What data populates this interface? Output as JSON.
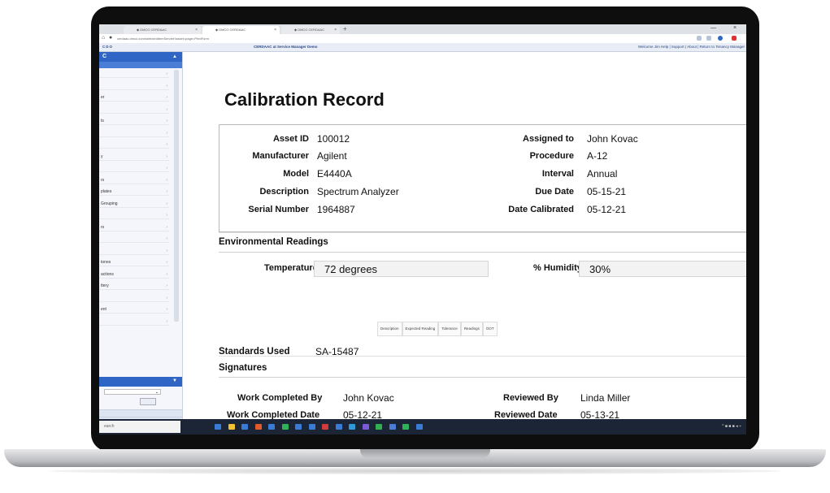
{
  "browser": {
    "tabs": [
      {
        "label": "◆ DMCO CERDAAC",
        "active": false
      },
      {
        "label": "◆ DMCO CERDAAC",
        "active": true
      },
      {
        "label": "◆ DMCO CERDAAC",
        "active": false
      }
    ],
    "url": "cerdaac.dmco.com/selectedItemServlet?asset=page=PrintForm",
    "new_tab": "+",
    "window_min": "—",
    "window_close": "×"
  },
  "app_header": {
    "logo": "CDO",
    "title": "CERDAAC at Service Manager Demo",
    "links": "Welcome Jim  Help | Support | About | Return to Tenancy Manager"
  },
  "sidebar": {
    "head": "C",
    "items": [
      "",
      "",
      "er",
      "",
      "ts",
      "",
      "",
      "y",
      "",
      "rs",
      "plates",
      "Grouping",
      "",
      "rs",
      "",
      "",
      "tones",
      "actions",
      "ttery",
      "",
      "ent",
      ""
    ],
    "select_chevron": "⌄",
    "search_placeholder": "earch"
  },
  "record": {
    "title": "Calibration Record",
    "left_fields": [
      {
        "label": "Asset ID",
        "value": "100012"
      },
      {
        "label": "Manufacturer",
        "value": "Agilent"
      },
      {
        "label": "Model",
        "value": "E4440A"
      },
      {
        "label": "Description",
        "value": "Spectrum Analyzer"
      },
      {
        "label": "Serial Number",
        "value": "1964887"
      }
    ],
    "right_fields": [
      {
        "label": "Assigned to",
        "value": "John Kovac"
      },
      {
        "label": "Procedure",
        "value": "A-12"
      },
      {
        "label": "Interval",
        "value": "Annual"
      },
      {
        "label": "Due Date",
        "value": "05-15-21"
      },
      {
        "label": "Date Calibrated",
        "value": "05-12-21"
      }
    ]
  },
  "environmental": {
    "heading": "Environmental Readings",
    "temperature_label": "Temperature",
    "temperature_value": "72 degrees",
    "humidity_label": "% Humidity",
    "humidity_value": "30%",
    "reading_columns": [
      "Description",
      "Expected Reading",
      "Tolerance",
      "Readings",
      "OOT"
    ]
  },
  "standards": {
    "label": "Standards Used",
    "value": "SA-15487"
  },
  "signatures": {
    "heading": "Signatures",
    "completed_by_label": "Work Completed By",
    "completed_by_value": "John Kovac",
    "completed_date_label": "Work Completed Date",
    "completed_date_value": "05-12-21",
    "reviewed_by_label": "Reviewed By",
    "reviewed_by_value": "Linda Miller",
    "reviewed_date_label": "Reviewed Date",
    "reviewed_date_value": "05-13-21"
  },
  "taskbar": {
    "icon_colors": [
      "#3a7bd5",
      "#f2c230",
      "#3a7bd5",
      "#e05a2b",
      "#3a7bd5",
      "#2fb35a",
      "#3a7bd5",
      "#3a7bd5",
      "#d13b3b",
      "#3a7bd5",
      "#2f9ad9",
      "#7a5ad9",
      "#30b050",
      "#4a7ed6",
      "#2fb35a",
      "#3a7bd5"
    ],
    "tray": "^  ■  ■  ■  ◂  ⌁"
  },
  "colors": {
    "accent": "#2f66c6",
    "header_bg": "#e9edf5",
    "taskbar": "#1c2535"
  }
}
